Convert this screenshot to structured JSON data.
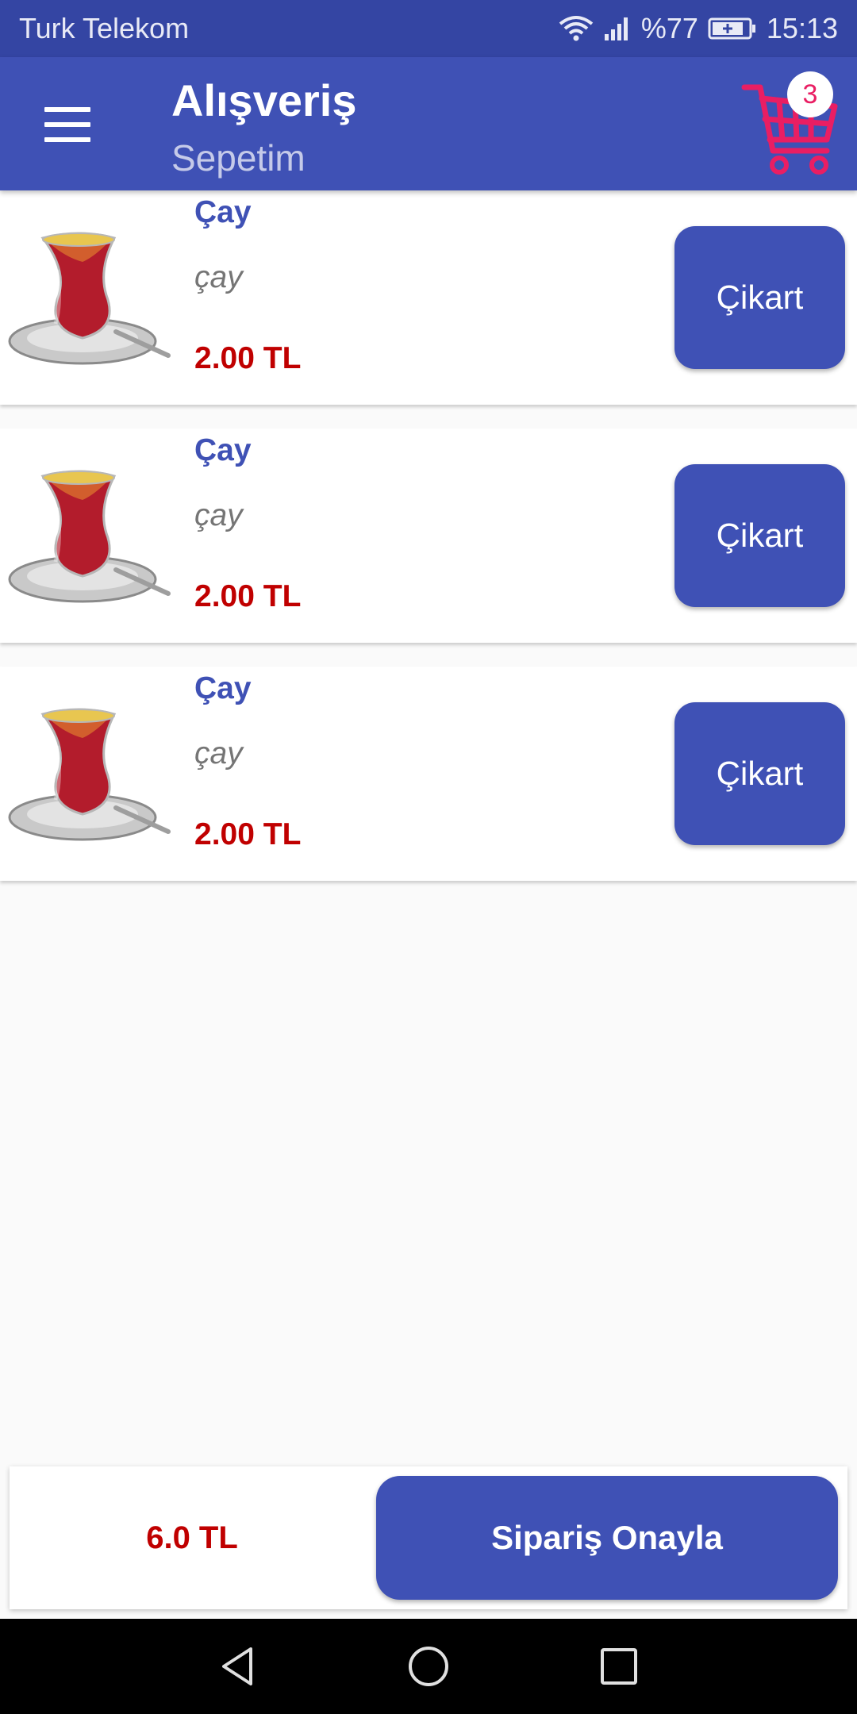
{
  "status_bar": {
    "carrier": "Turk Telekom",
    "battery": "%77",
    "time": "15:13",
    "icons": [
      "wifi-icon",
      "signal-icon",
      "battery-icon"
    ]
  },
  "app_bar": {
    "title": "Alışveriş",
    "subtitle": "Sepetim",
    "cart_count": "3",
    "icons": [
      "menu-icon",
      "shopping-cart-icon"
    ]
  },
  "cart_items": [
    {
      "name": "Çay",
      "description": "çay",
      "price": "2.00 TL",
      "remove_label": "Çikart",
      "image": "tea-glass-image"
    },
    {
      "name": "Çay",
      "description": "çay",
      "price": "2.00 TL",
      "remove_label": "Çikart",
      "image": "tea-glass-image"
    },
    {
      "name": "Çay",
      "description": "çay",
      "price": "2.00 TL",
      "remove_label": "Çikart",
      "image": "tea-glass-image"
    }
  ],
  "footer": {
    "total": "6.0 TL",
    "confirm_label": "Sipariş Onayla"
  },
  "nav_bar": {
    "icons": [
      "back-icon",
      "home-icon",
      "recents-icon"
    ]
  },
  "colors": {
    "status_bar": "#3445a3",
    "primary": "#3f51b5",
    "subtitle": "#c5cae9",
    "price": "#c00000",
    "cart_icon": "#e91e63",
    "background": "#fafafa"
  }
}
